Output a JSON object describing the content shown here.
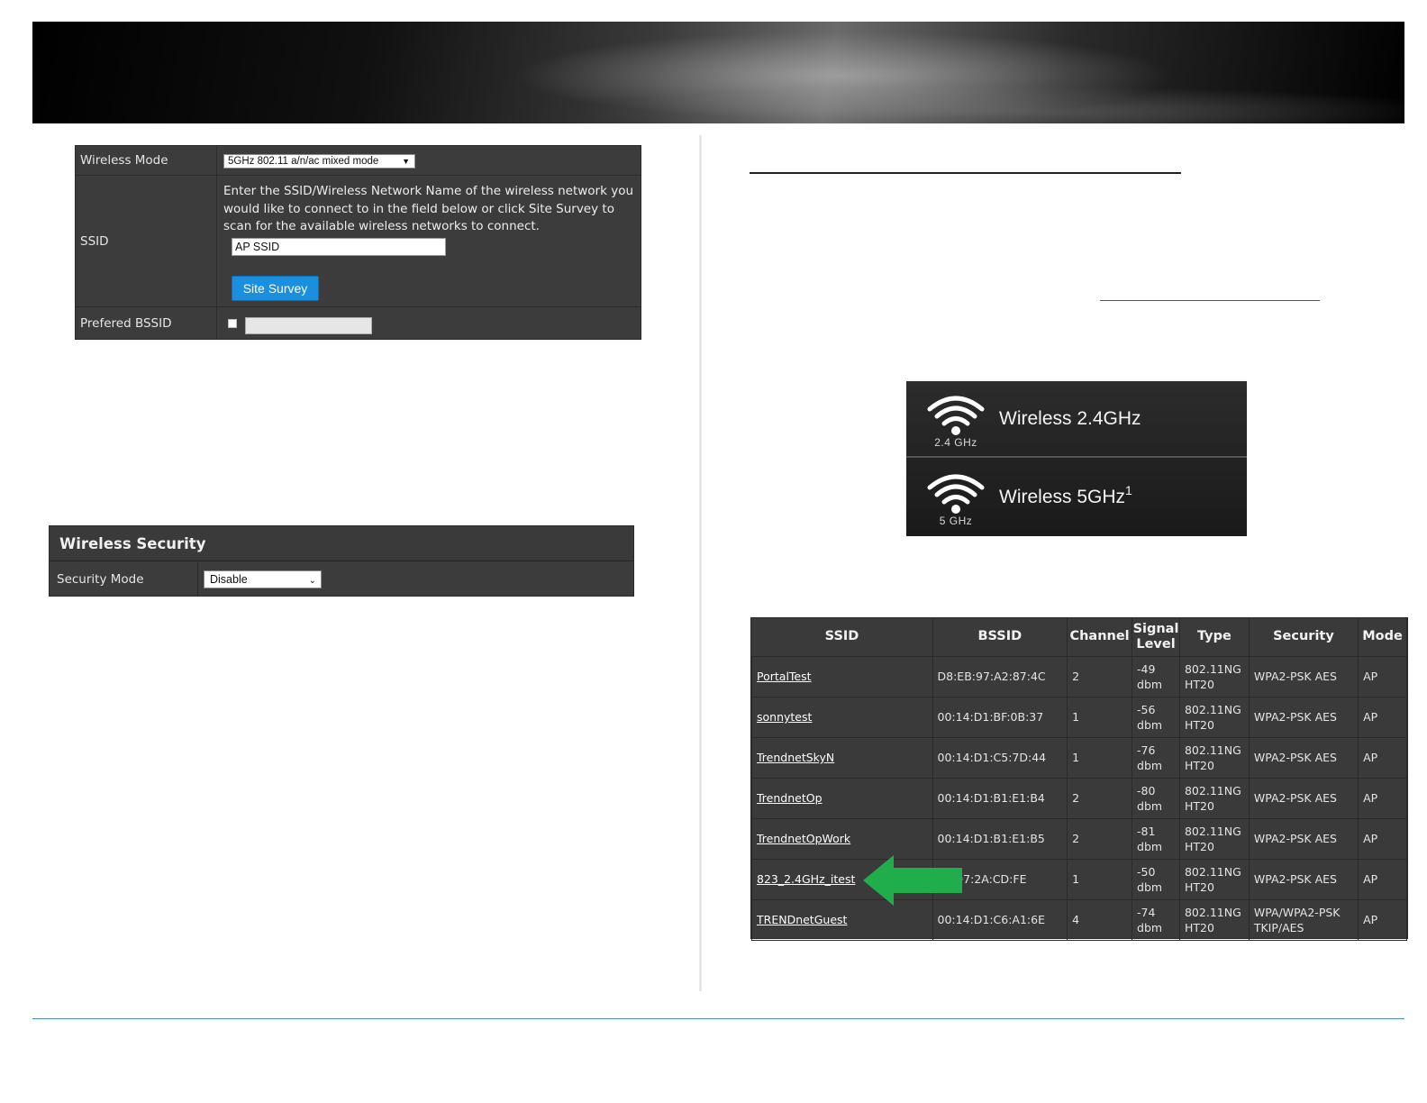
{
  "wireless_mode": {
    "label": "Wireless Mode",
    "value": "5GHz 802.11 a/n/ac mixed mode"
  },
  "ssid": {
    "label": "SSID",
    "description": "Enter the SSID/Wireless Network Name of the wireless network you would like to connect to in the field below or click Site Survey to scan for the available wireless networks to connect.",
    "value": "AP SSID",
    "button": "Site Survey"
  },
  "preferred_bssid": {
    "label": "Prefered BSSID",
    "value": ""
  },
  "wireless_security": {
    "title": "Wireless Security",
    "label": "Security Mode",
    "value": "Disable"
  },
  "bands": [
    {
      "icon": "wifi-icon",
      "icon_label": "2.4 GHz",
      "title": "Wireless 2.4GHz",
      "sup": ""
    },
    {
      "icon": "wifi-icon",
      "icon_label": "5 GHz",
      "title": "Wireless 5GHz",
      "sup": "1"
    }
  ],
  "survey": {
    "headers": [
      "SSID",
      "BSSID",
      "Channel",
      "Signal Level",
      "Type",
      "Security",
      "Mode"
    ],
    "rows": [
      {
        "ssid": "PortalTest",
        "bssid": "D8:EB:97:A2:87:4C",
        "channel": "2",
        "signal": "-49 dbm",
        "type": "802.11NG HT20",
        "security": "WPA2-PSK AES",
        "mode": "AP"
      },
      {
        "ssid": "sonnytest",
        "bssid": "00:14:D1:BF:0B:37",
        "channel": "1",
        "signal": "-56 dbm",
        "type": "802.11NG HT20",
        "security": "WPA2-PSK AES",
        "mode": "AP"
      },
      {
        "ssid": "TrendnetSkyN",
        "bssid": "00:14:D1:C5:7D:44",
        "channel": "1",
        "signal": "-76 dbm",
        "type": "802.11NG HT20",
        "security": "WPA2-PSK AES",
        "mode": "AP"
      },
      {
        "ssid": "TrendnetOp",
        "bssid": "00:14:D1:B1:E1:B4",
        "channel": "2",
        "signal": "-80 dbm",
        "type": "802.11NG HT20",
        "security": "WPA2-PSK AES",
        "mode": "AP"
      },
      {
        "ssid": "TrendnetOpWork",
        "bssid": "00:14:D1:B1:E1:B5",
        "channel": "2",
        "signal": "-81 dbm",
        "type": "802.11NG HT20",
        "security": "WPA2-PSK AES",
        "mode": "AP"
      },
      {
        "ssid": "823_2.4GHz_itest",
        "bssid": "EB:97:2A:CD:FE",
        "channel": "1",
        "signal": "-50 dbm",
        "type": "802.11NG HT20",
        "security": "WPA2-PSK AES",
        "mode": "AP"
      },
      {
        "ssid": "TRENDnetGuest",
        "bssid": "00:14:D1:C6:A1:6E",
        "channel": "4",
        "signal": "-74 dbm",
        "type": "802.11NG HT20",
        "security": "WPA/WPA2-PSK TKIP/AES",
        "mode": "AP"
      }
    ]
  },
  "colors": {
    "panel_bg": "#3c3c3c",
    "button_blue": "#1a8fe0",
    "arrow_green": "#1fae4b",
    "footer_line": "#4a8bc8"
  }
}
